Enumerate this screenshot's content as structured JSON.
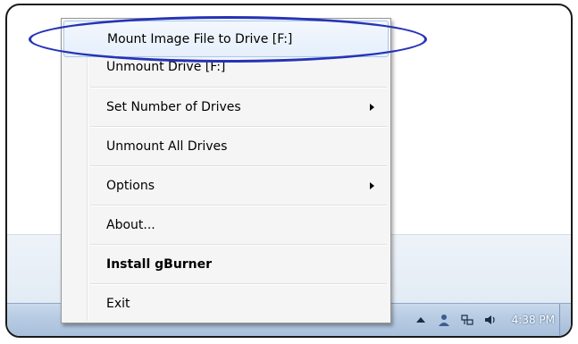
{
  "menu": {
    "items": [
      {
        "label": "Mount Image File to Drive [F:]",
        "submenu": false,
        "hovered": true,
        "bold": false
      },
      {
        "label": "Unmount Drive [F:]",
        "submenu": false,
        "hovered": false,
        "bold": false
      },
      {
        "label": "Set Number of Drives",
        "submenu": true,
        "hovered": false,
        "bold": false
      },
      {
        "label": "Unmount All Drives",
        "submenu": false,
        "hovered": false,
        "bold": false
      },
      {
        "label": "Options",
        "submenu": true,
        "hovered": false,
        "bold": false
      },
      {
        "label": "About...",
        "submenu": false,
        "hovered": false,
        "bold": false
      },
      {
        "label": "Install gBurner",
        "submenu": false,
        "hovered": false,
        "bold": true
      },
      {
        "label": "Exit",
        "submenu": false,
        "hovered": false,
        "bold": false
      }
    ]
  },
  "taskbar": {
    "clock": "4:38 PM",
    "tray_icons": [
      "show-hidden-icons-arrow",
      "user-icon",
      "network-icon",
      "speaker-icon"
    ]
  },
  "colors": {
    "annotation_oval": "#2533b7",
    "menu_background": "#f5f5f5",
    "hover_border": "#a8c8ec"
  }
}
